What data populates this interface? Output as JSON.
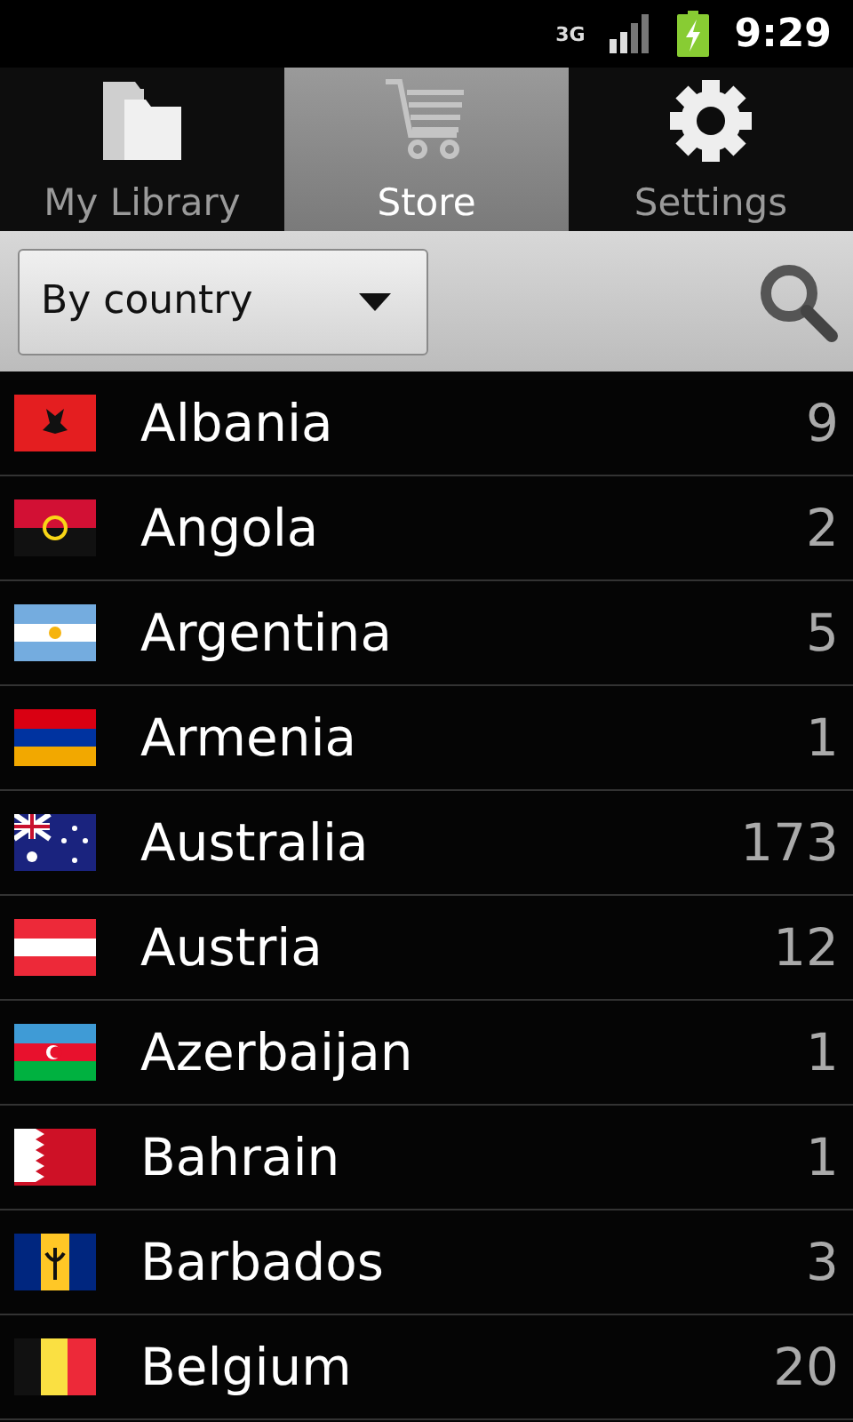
{
  "status_bar": {
    "network": "3G",
    "time": "9:29"
  },
  "tabs": [
    {
      "label": "My Library",
      "kind": "folder",
      "selected": false
    },
    {
      "label": "Store",
      "kind": "cart",
      "selected": true
    },
    {
      "label": "Settings",
      "kind": "gear",
      "selected": false
    }
  ],
  "filter": {
    "value": "By country"
  },
  "countries": [
    {
      "name": "Albania",
      "count": "9",
      "kind": "albania"
    },
    {
      "name": "Angola",
      "count": "2",
      "kind": "angola"
    },
    {
      "name": "Argentina",
      "count": "5",
      "kind": "argentina"
    },
    {
      "name": "Armenia",
      "count": "1",
      "kind": "armenia"
    },
    {
      "name": "Australia",
      "count": "173",
      "kind": "australia"
    },
    {
      "name": "Austria",
      "count": "12",
      "kind": "austria"
    },
    {
      "name": "Azerbaijan",
      "count": "1",
      "kind": "azerbaijan"
    },
    {
      "name": "Bahrain",
      "count": "1",
      "kind": "bahrain"
    },
    {
      "name": "Barbados",
      "count": "3",
      "kind": "barbados"
    },
    {
      "name": "Belgium",
      "count": "20",
      "kind": "belgium"
    }
  ]
}
